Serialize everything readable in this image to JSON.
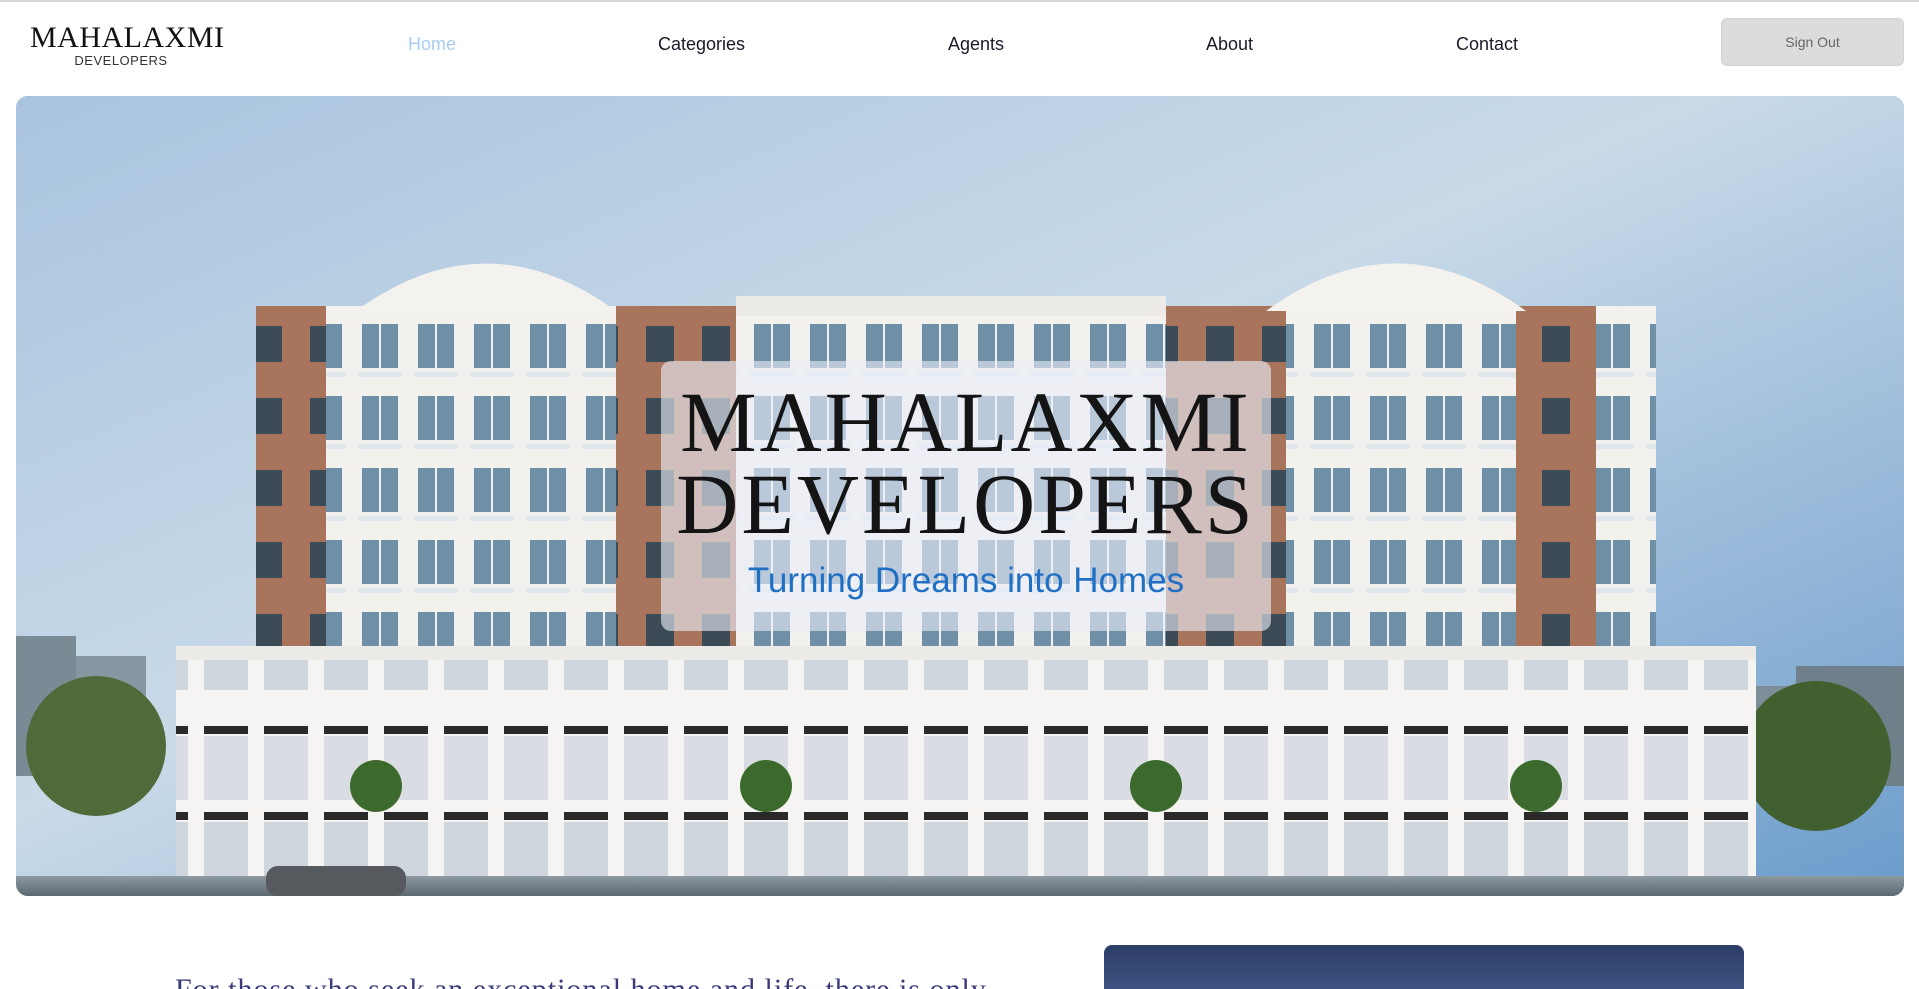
{
  "brand": {
    "name": "MAHALAXMI",
    "sub": "DEVELOPERS"
  },
  "nav": {
    "items": [
      {
        "label": "Home",
        "active": true
      },
      {
        "label": "Categories",
        "active": false
      },
      {
        "label": "Agents",
        "active": false
      },
      {
        "label": "About",
        "active": false
      },
      {
        "label": "Contact",
        "active": false
      }
    ],
    "signout_label": "Sign Out"
  },
  "hero": {
    "title_line1": "MAHALAXMI",
    "title_line2": "DEVELOPERS",
    "tagline": "Turning Dreams into Homes",
    "image": "building-render"
  },
  "intro": {
    "text": "For those who seek an exceptional home and life, there is only"
  },
  "colors": {
    "nav_active": "#a9cdf0",
    "tagline": "#1f6fc4",
    "intro_text": "#3a3a7a",
    "signout_bg": "#dcdcdc"
  }
}
